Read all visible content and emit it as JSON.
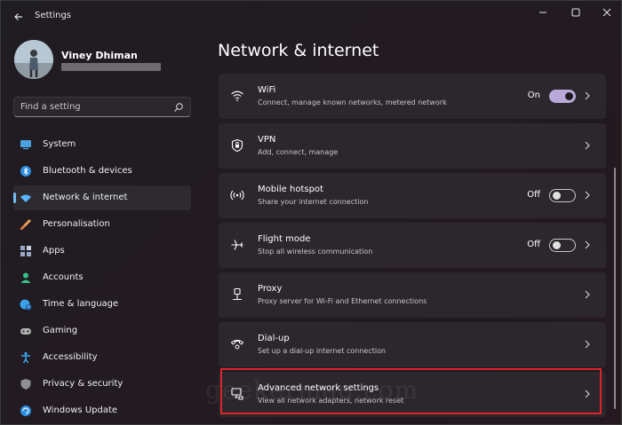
{
  "window": {
    "title": "Settings"
  },
  "profile": {
    "name": "Viney Dhiman"
  },
  "search": {
    "placeholder": "Find a setting"
  },
  "nav": {
    "items": [
      {
        "label": "System",
        "icon": "monitor-icon",
        "color": "#4aa3df"
      },
      {
        "label": "Bluetooth & devices",
        "icon": "bluetooth-icon",
        "color": "#2f8ee0"
      },
      {
        "label": "Network & internet",
        "icon": "wifi-icon",
        "color": "#5ab4ff",
        "selected": true
      },
      {
        "label": "Personalisation",
        "icon": "brush-icon",
        "color": "#e7a25b"
      },
      {
        "label": "Apps",
        "icon": "apps-icon",
        "color": "#9aa8c7"
      },
      {
        "label": "Accounts",
        "icon": "person-icon",
        "color": "#33c48a"
      },
      {
        "label": "Time & language",
        "icon": "globe-clock-icon",
        "color": "#3aa0e8"
      },
      {
        "label": "Gaming",
        "icon": "gamepad-icon",
        "color": "#b4b4b4"
      },
      {
        "label": "Accessibility",
        "icon": "accessibility-icon",
        "color": "#3ea7f0"
      },
      {
        "label": "Privacy & security",
        "icon": "shield-icon",
        "color": "#8f8f96"
      },
      {
        "label": "Windows Update",
        "icon": "update-icon",
        "color": "#2d8fe0"
      }
    ]
  },
  "main": {
    "title": "Network & internet",
    "cards": [
      {
        "title": "WiFi",
        "subtitle": "Connect, manage known networks, metered network",
        "icon": "wifi-icon",
        "state": "On"
      },
      {
        "title": "VPN",
        "subtitle": "Add, connect, manage",
        "icon": "vpn-shield-icon"
      },
      {
        "title": "Mobile hotspot",
        "subtitle": "Share your internet connection",
        "icon": "hotspot-icon",
        "state": "Off"
      },
      {
        "title": "Flight mode",
        "subtitle": "Stop all wireless communication",
        "icon": "airplane-icon",
        "state": "Off"
      },
      {
        "title": "Proxy",
        "subtitle": "Proxy server for Wi-Fi and Ethernet connections",
        "icon": "proxy-icon"
      },
      {
        "title": "Dial-up",
        "subtitle": "Set up a dial-up internet connection",
        "icon": "dialup-icon"
      },
      {
        "title": "Advanced network settings",
        "subtitle": "View all network adapters, network reset",
        "icon": "network-adapter-icon"
      }
    ]
  },
  "watermark": "geekermag.com",
  "colors": {
    "accent": "#76b9ed",
    "toggle_on": "#b9a9d9",
    "highlight": "#e0232b"
  }
}
